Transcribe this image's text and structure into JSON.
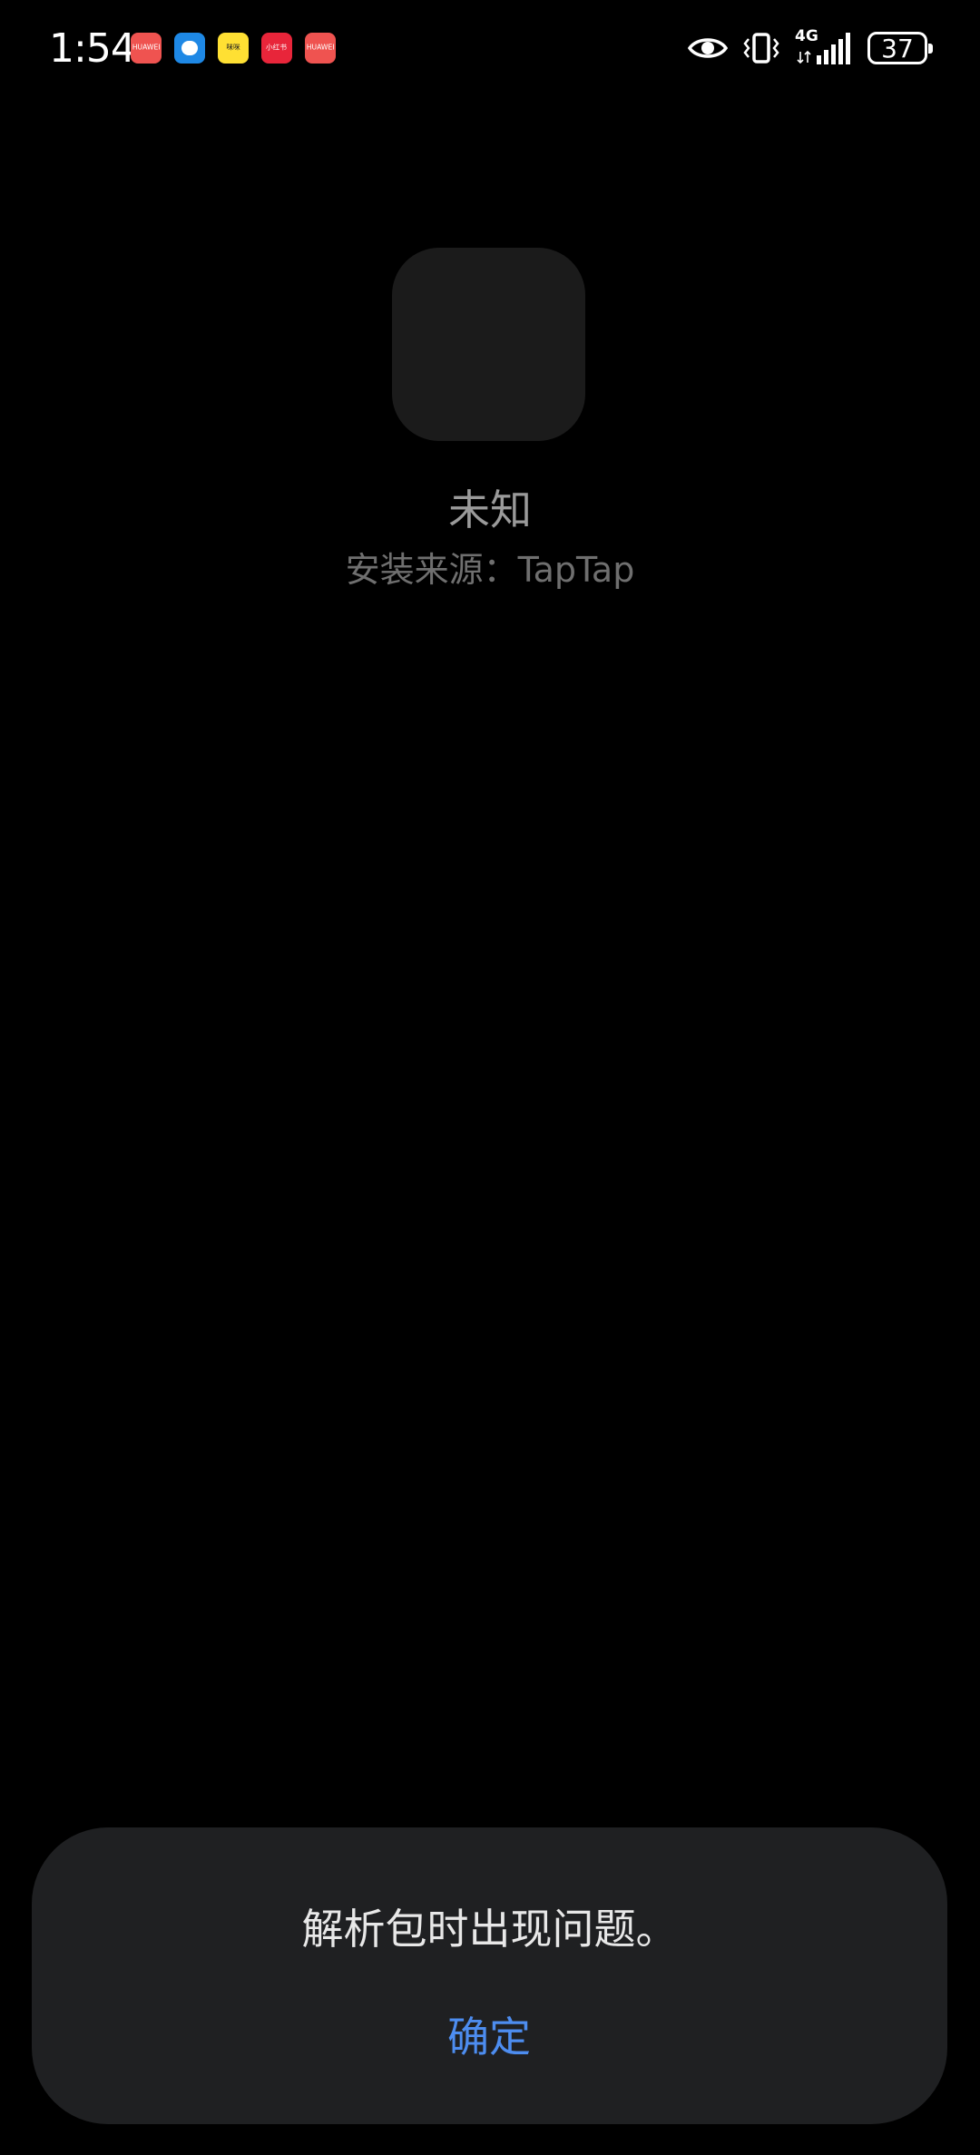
{
  "status_bar": {
    "time": "1:54",
    "notifications": [
      {
        "icon": "app-icon-1",
        "label": "HUAWEI",
        "color": "#ef5350"
      },
      {
        "icon": "message-icon",
        "label": "",
        "color": "#1e88e5"
      },
      {
        "icon": "app-icon-3",
        "label": "咪咪",
        "color": "#ffe033"
      },
      {
        "icon": "xiaohongshu-icon",
        "label": "小红书",
        "color": "#e8253a"
      },
      {
        "icon": "app-icon-5",
        "label": "HUAWEI",
        "color": "#ef5350"
      }
    ],
    "network": "4G",
    "battery": "37"
  },
  "app": {
    "name": "未知",
    "source": "安装来源：TapTap"
  },
  "dialog": {
    "message": "解析包时出现问题。",
    "confirm_label": "确定"
  },
  "colors": {
    "accent": "#4d8df0",
    "background": "#000000",
    "dialog_bg": "#1f2022"
  }
}
